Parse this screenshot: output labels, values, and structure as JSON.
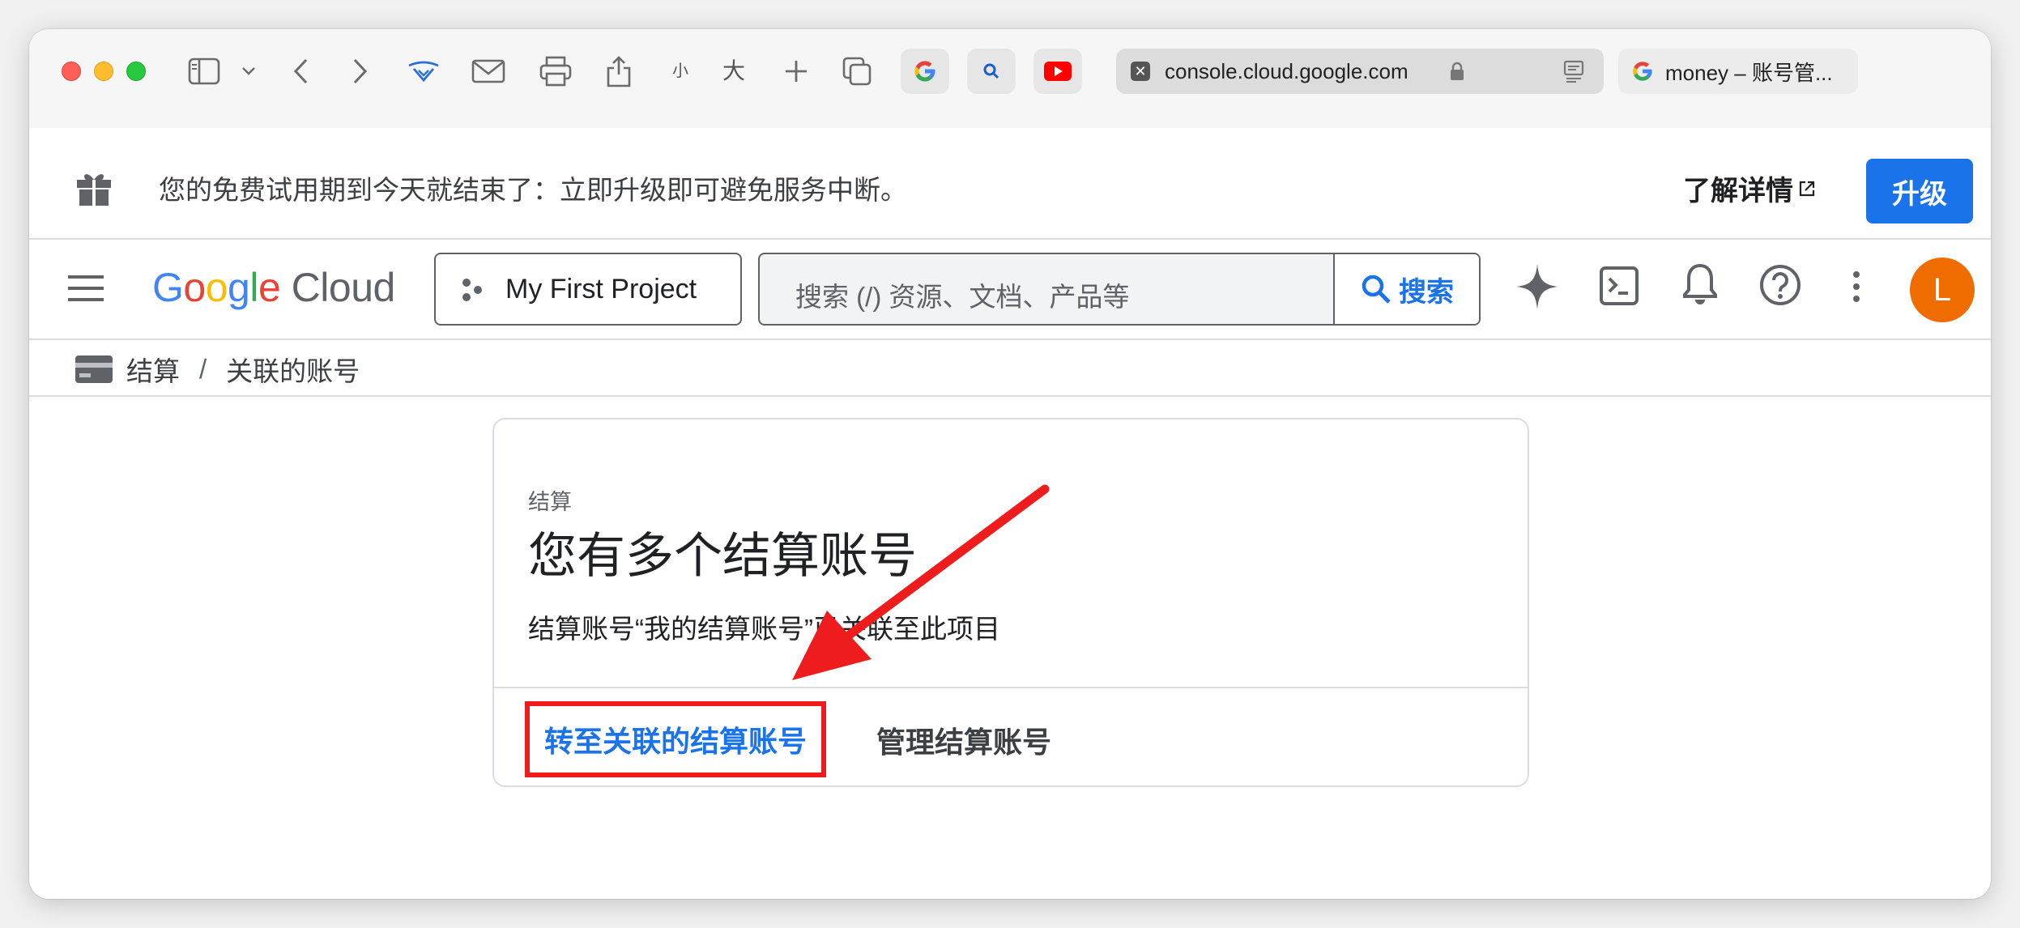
{
  "browser": {
    "address": "console.cloud.google.com",
    "second_tab_title": "money – 账号管...",
    "text_size_small": "小",
    "text_size_large": "大"
  },
  "banner": {
    "message": "您的免费试用期到今天就结束了：立即升级即可避免服务中断。",
    "learn_more": "了解详情",
    "upgrade": "升级"
  },
  "header": {
    "logo_letters": [
      "G",
      "o",
      "o",
      "g",
      "l",
      "e"
    ],
    "logo_cloud": "Cloud",
    "project_name": "My First Project",
    "search_placeholder": "搜索 (/) 资源、文档、产品等",
    "search_button": "搜索",
    "avatar_letter": "L"
  },
  "breadcrumb": {
    "items": [
      "结算",
      "关联的账号"
    ],
    "separator": "/"
  },
  "card": {
    "eyebrow": "结算",
    "title": "您有多个结算账号",
    "body": "结算账号“我的结算账号”已关联至此项目",
    "primary_action": "转至关联的结算账号",
    "secondary_action": "管理结算账号"
  },
  "colors": {
    "accent": "#1a73e8",
    "annotation_red": "#ee1c1c",
    "avatar": "#ef6c00"
  }
}
